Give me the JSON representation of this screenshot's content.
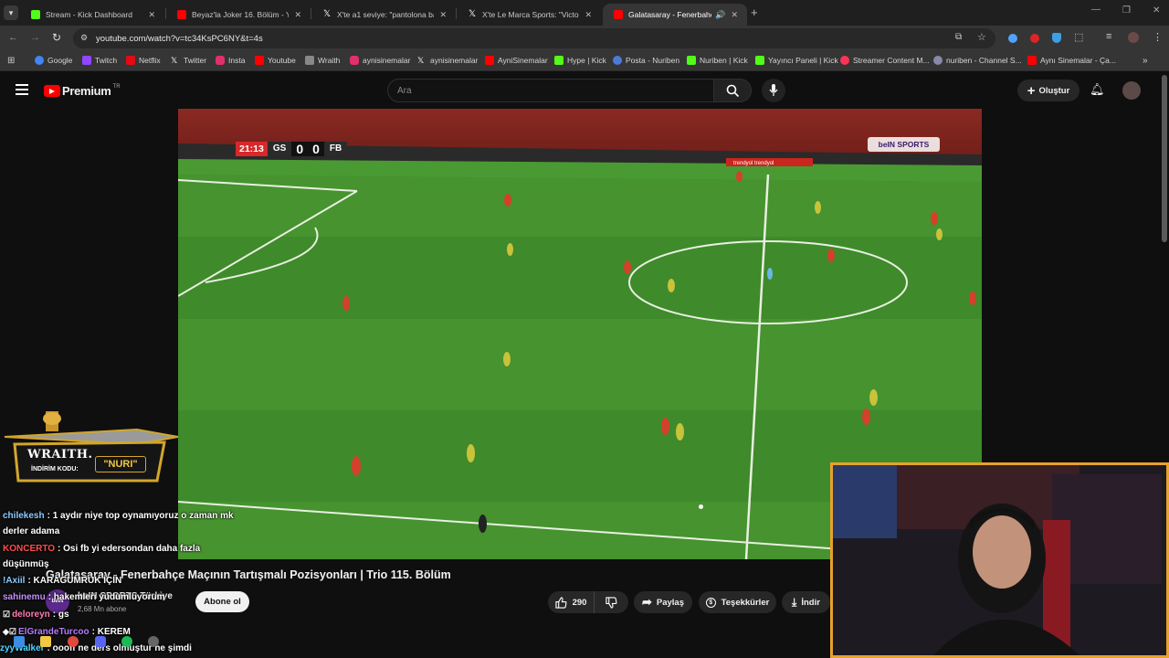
{
  "tabs": [
    {
      "title": "Stream - Kick Dashboard",
      "color": "#53fc18",
      "active": false
    },
    {
      "title": "Beyaz'la Joker 16. Bölüm - YouT",
      "color": "#ff0000",
      "active": false
    },
    {
      "title": "X'te a1 seviye: \"pantolona bak c",
      "color": "#ffffff",
      "active": false
    },
    {
      "title": "X'te Le Marca Sports: \"Victor O:",
      "color": "#ffffff",
      "active": false
    },
    {
      "title": "Galatasaray - Fenerbahçe M",
      "color": "#ff0000",
      "active": true
    }
  ],
  "address": {
    "url": "youtube.com/watch?v=tc34KsPC6NY&t=4s"
  },
  "bookmarks": [
    {
      "label": "Google",
      "color": "#4285f4"
    },
    {
      "label": "Twitch",
      "color": "#9146ff"
    },
    {
      "label": "Netflix",
      "color": "#e50914"
    },
    {
      "label": "Twitter",
      "color": "#ffffff"
    },
    {
      "label": "Insta",
      "color": "#e1306c"
    },
    {
      "label": "Youtube",
      "color": "#ff0000"
    },
    {
      "label": "Wraith",
      "color": "#888888"
    },
    {
      "label": "aynisinemalar",
      "color": "#e1306c"
    },
    {
      "label": "aynisinemalar",
      "color": "#ffffff"
    },
    {
      "label": "AyniSinemalar",
      "color": "#ff0000"
    },
    {
      "label": "Hype | Kick",
      "color": "#53fc18"
    },
    {
      "label": "Posta - Nuriben",
      "color": "#4a7bd8"
    },
    {
      "label": "Nuriben | Kick",
      "color": "#53fc18"
    },
    {
      "label": "Yayıncı Paneli | Kick",
      "color": "#53fc18"
    },
    {
      "label": "Streamer Content M...",
      "color": "#ff3355"
    },
    {
      "label": "nuriben - Channel S...",
      "color": "#8888aa"
    },
    {
      "label": "Aynı Sinemalar - Ça...",
      "color": "#ff0000"
    }
  ],
  "youtube": {
    "logo": "Premium",
    "region": "TR",
    "search_placeholder": "Ara",
    "create_label": "Oluştur",
    "video_title": "Galatasaray - Fenerbahçe Maçının Tartışmalı Pozisyonları | Trio 115. Bölüm",
    "channel_name": "beIN SPORTS Türkiye",
    "subscribers": "2,68 Mn abone",
    "subscribe_label": "Abone ol",
    "likes": "290",
    "share_label": "Paylaş",
    "thanks_label": "Teşekkürler",
    "download_label": "İndir"
  },
  "scoreboard": {
    "clock": "21:13",
    "home": "GS",
    "home_score": "0",
    "away_score": "0",
    "away": "FB",
    "broadcaster": "beIN SPORTS"
  },
  "overlay": {
    "banner_brand": "WRAITH.",
    "banner_code_label": "İNDİRİM KODU:",
    "banner_code": "\"NURI\"",
    "chat": [
      {
        "user": "chilekesh",
        "color": "#8ecbff",
        "text": ": 1 aydır niye top oynamıyoruz o zaman mk"
      },
      {
        "user": "",
        "color": "#ffffff",
        "text": "derler adama"
      },
      {
        "user": "KONCERTO",
        "color": "#ff4d4d",
        "text": ": Osi fb yi edersondan daha fazla"
      },
      {
        "user": "",
        "color": "#ffffff",
        "text": "düşünmüş"
      },
      {
        "user": "!Axiil",
        "color": "#8ecbff",
        "text": ": KARAGUMRUK İÇİN"
      },
      {
        "user": "sahinemu",
        "color": "#c58fff",
        "text": ": hakemleri yudumluyorum"
      },
      {
        "user": "deloreyn",
        "color": "#ff7db3",
        "text": ": gs"
      },
      {
        "user": "ElGrandeTurcoo",
        "color": "#b87cff",
        "text": ": KEREM"
      },
      {
        "user": "zyyWalker",
        "color": "#4fd6ff",
        "text": ": oooff ne ders olmuştur he şimdi"
      }
    ]
  }
}
